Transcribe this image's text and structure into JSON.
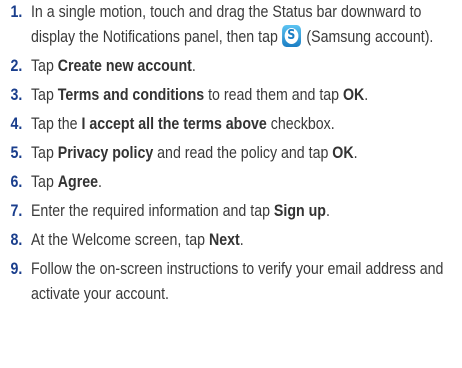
{
  "steps": [
    {
      "number": "1.",
      "text_a": "In a single motion, touch and drag the Status bar downward to display the Notifications panel, then tap ",
      "icon": "samsung-account-icon",
      "icon_glyph": "S",
      "text_b": " (Samsung account)."
    },
    {
      "number": "2.",
      "pre": "Tap ",
      "bold": "Create new account",
      "post": "."
    },
    {
      "number": "3.",
      "pre": "Tap ",
      "bold": "Terms and conditions",
      "mid": " to read them and tap ",
      "bold2": "OK",
      "post": "."
    },
    {
      "number": "4.",
      "pre": "Tap the ",
      "bold": "I accept all the terms above",
      "post": " checkbox."
    },
    {
      "number": "5.",
      "pre": "Tap ",
      "bold": "Privacy policy",
      "mid": " and read the policy and tap ",
      "bold2": "OK",
      "post": "."
    },
    {
      "number": "6.",
      "pre": "Tap ",
      "bold": "Agree",
      "post": "."
    },
    {
      "number": "7.",
      "pre": "Enter the required information and tap ",
      "bold": "Sign up",
      "post": "."
    },
    {
      "number": "8.",
      "pre": "At the Welcome screen, tap ",
      "bold": "Next",
      "post": "."
    },
    {
      "number": "9.",
      "text": "Follow the on-screen instructions to verify your email address and activate your account."
    }
  ],
  "colors": {
    "number": "#1a3e8c",
    "text": "#3a3a3a",
    "icon": "#1b7ec4"
  }
}
